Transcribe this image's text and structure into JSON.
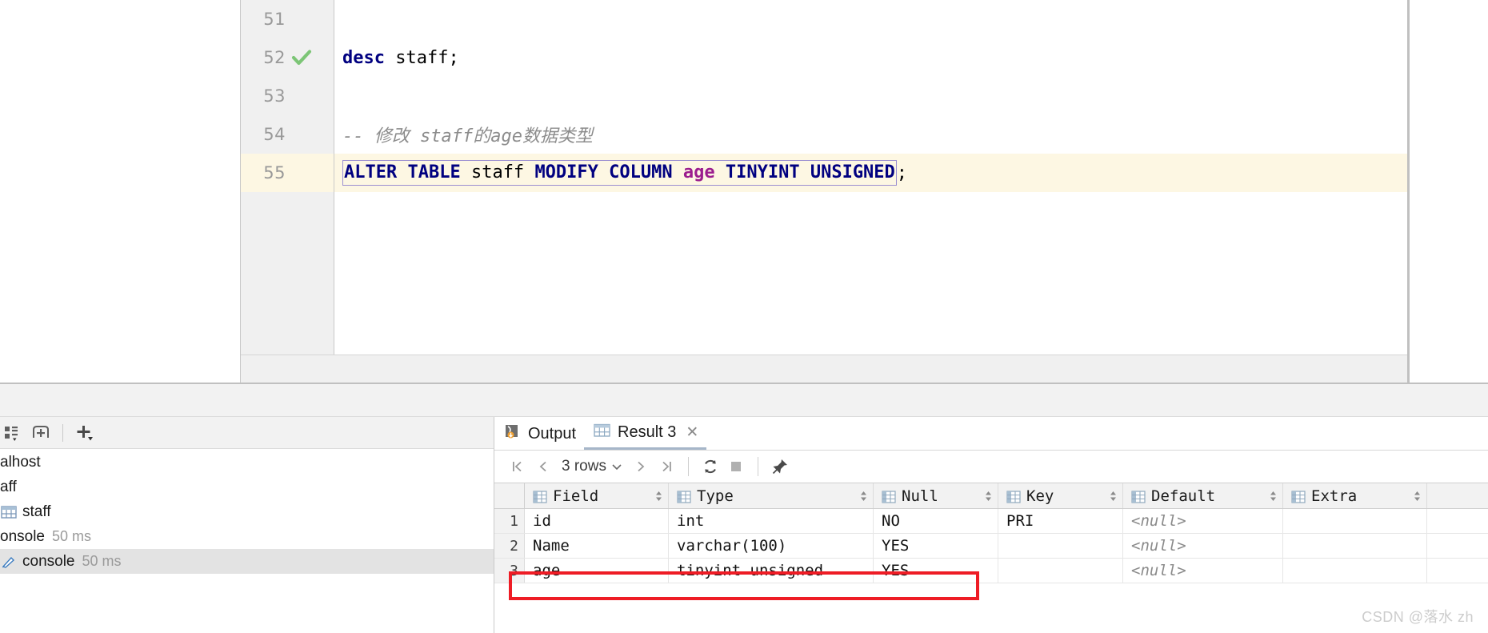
{
  "editor": {
    "lines": [
      {
        "number": "51",
        "status": "",
        "tokens": []
      },
      {
        "number": "52",
        "status": "check",
        "tokens": [
          {
            "text": "desc",
            "style": "kw"
          },
          {
            "text": " ",
            "style": "punc"
          },
          {
            "text": "staff",
            "style": "ident"
          },
          {
            "text": ";",
            "style": "punc"
          }
        ]
      },
      {
        "number": "53",
        "status": "",
        "tokens": []
      },
      {
        "number": "54",
        "status": "",
        "tokens": [
          {
            "text": "-- 修改 staff的age数据类型",
            "style": "comment"
          }
        ]
      },
      {
        "number": "55",
        "status": "",
        "highlighted": true,
        "selected": true,
        "tokens": [
          {
            "text": "ALTER TABLE ",
            "style": "kw"
          },
          {
            "text": "staff",
            "style": "ident"
          },
          {
            "text": " ",
            "style": "punc"
          },
          {
            "text": "MODIFY COLUMN ",
            "style": "kw"
          },
          {
            "text": "age",
            "style": "colname"
          },
          {
            "text": " ",
            "style": "punc"
          },
          {
            "text": "TINYINT UNSIGNED",
            "style": "kw"
          }
        ],
        "trailing": ";"
      }
    ],
    "colors": {
      "keyword": "#000080",
      "identifier": "#000000",
      "column": "#9b1d8e",
      "comment": "#8c8c8c",
      "line_highlight": "#fdf7e3",
      "selection_border": "#9b8fd1",
      "check_mark": "#7cc576"
    }
  },
  "db_panel": {
    "toolbar": [
      {
        "name": "group-by-icon",
        "label": ""
      },
      {
        "name": "add-data-source-icon",
        "label": ""
      },
      {
        "name": "new-icon",
        "label": ""
      }
    ],
    "tree": [
      {
        "label": "alhost",
        "icon": "",
        "selected": false,
        "meta": ""
      },
      {
        "label": "aff",
        "icon": "",
        "selected": false,
        "meta": ""
      },
      {
        "label": "staff",
        "icon": "table-icon",
        "selected": false,
        "meta": ""
      },
      {
        "label": "onsole",
        "icon": "",
        "selected": false,
        "meta": "50 ms"
      },
      {
        "label": "console",
        "icon": "console-icon",
        "selected": true,
        "meta": "50 ms"
      }
    ]
  },
  "results": {
    "tabs": [
      {
        "label": "Output",
        "icon": "output-icon",
        "active": false,
        "closable": false
      },
      {
        "label": "Result 3",
        "icon": "grid-icon",
        "active": true,
        "closable": true,
        "close_label": "✕"
      }
    ],
    "toolbar": {
      "first_label": "|<",
      "prev_label": "<",
      "rows_label": "3 rows",
      "rows_dropdown": "⌄",
      "next_label": ">",
      "last_label": ">|",
      "refresh_label": "refresh-icon",
      "stop_label": "stop-icon",
      "pin_label": "pin-icon"
    },
    "grid": {
      "columns": [
        "Field",
        "Type",
        "Null",
        "Key",
        "Default",
        "Extra"
      ],
      "sort_indicator": "⇅",
      "rows": [
        {
          "n": "1",
          "Field": "id",
          "Type": "int",
          "Null": "NO",
          "Key": "PRI",
          "Default": "<null>",
          "Extra": ""
        },
        {
          "n": "2",
          "Field": "Name",
          "Type": "varchar(100)",
          "Null": "YES",
          "Key": "",
          "Default": "<null>",
          "Extra": ""
        },
        {
          "n": "3",
          "Field": "age",
          "Type": "tinyint unsigned",
          "Null": "YES",
          "Key": "",
          "Default": "<null>",
          "Extra": ""
        }
      ]
    },
    "annotation": {
      "color": "#ee1c25"
    }
  },
  "watermark": {
    "text": "CSDN @落水 zh"
  }
}
